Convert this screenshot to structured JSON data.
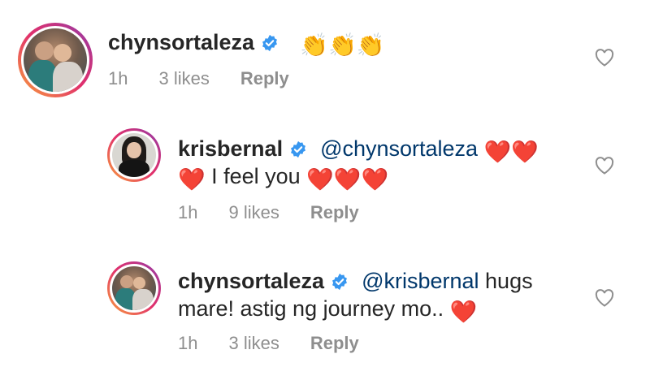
{
  "comments": [
    {
      "username": "chynsortaleza",
      "verified": true,
      "body_line1": "",
      "emoji_line1": "👏👏👏",
      "time": "1h",
      "likes": "3 likes",
      "reply_label": "Reply"
    },
    {
      "username": "krisbernal",
      "verified": true,
      "mention": "@chynsortaleza",
      "emoji_after_mention": "❤️❤️",
      "line2_prefix_emoji": "❤️",
      "line2_text": " I feel you ",
      "line2_suffix_emoji": "❤️❤️❤️",
      "time": "1h",
      "likes": "9 likes",
      "reply_label": "Reply"
    },
    {
      "username": "chynsortaleza",
      "verified": true,
      "mention": "@krisbernal",
      "line1_text": " hugs",
      "line2_text": "mare! astig ng journey mo.. ",
      "line2_suffix_emoji": "❤️",
      "time": "1h",
      "likes": "3 likes",
      "reply_label": "Reply"
    }
  ],
  "colors": {
    "verified_blue": "#3897f0",
    "mention_blue": "#00376b",
    "meta_gray": "#8e8e8e",
    "heart_red": "#e0245e"
  },
  "icons": {
    "verified": "verified-badge-icon",
    "like": "heart-outline-icon"
  }
}
